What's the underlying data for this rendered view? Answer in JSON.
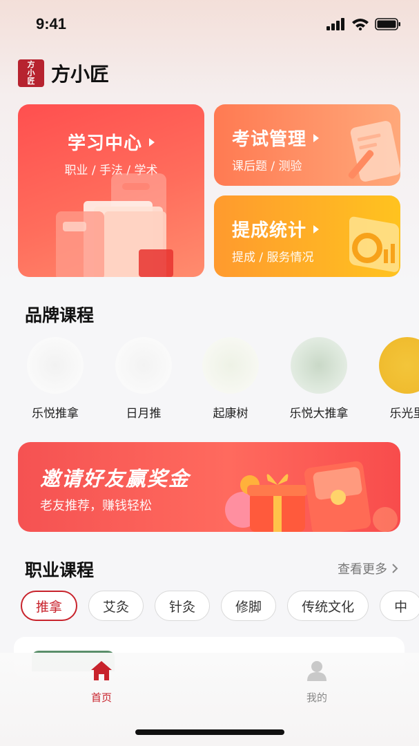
{
  "status_bar": {
    "time": "9:41"
  },
  "app": {
    "logo_text": [
      "方",
      "小",
      "匠"
    ],
    "title": "方小匠"
  },
  "cards": {
    "learn": {
      "title": "学习中心",
      "subtitle": "职业 / 手法 / 学术"
    },
    "exam": {
      "title": "考试管理",
      "subtitle": "课后题 / 测验"
    },
    "stats": {
      "title": "提成统计",
      "subtitle": "提成 / 服务情况"
    }
  },
  "brand_section": {
    "title": "品牌课程",
    "items": [
      {
        "name": "乐悦推拿"
      },
      {
        "name": "日月推"
      },
      {
        "name": "起康树"
      },
      {
        "name": "乐悦大推拿"
      },
      {
        "name": "乐光里"
      }
    ]
  },
  "banner": {
    "title": "邀请好友赢奖金",
    "subtitle": "老友推荐，赚钱轻松"
  },
  "career_section": {
    "title": "职业课程",
    "more": "查看更多",
    "tags": [
      {
        "label": "推拿",
        "active": true
      },
      {
        "label": "艾灸",
        "active": false
      },
      {
        "label": "针灸",
        "active": false
      },
      {
        "label": "修脚",
        "active": false
      },
      {
        "label": "传统文化",
        "active": false
      },
      {
        "label": "中",
        "active": false
      }
    ]
  },
  "tab_bar": {
    "home": {
      "label": "首页",
      "color": "#c8232c"
    },
    "mine": {
      "label": "我的",
      "color": "#888888"
    }
  }
}
